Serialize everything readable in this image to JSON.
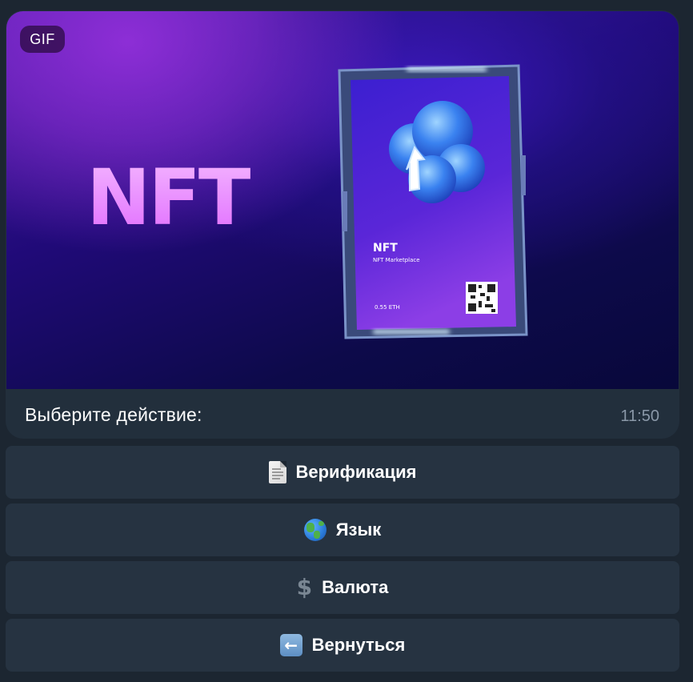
{
  "message": {
    "media_badge": "GIF",
    "media": {
      "headline": "NFT",
      "card_title": "NFT",
      "card_subtitle": "NFT Marketplace",
      "card_price": "0.55 ETH"
    },
    "caption": "Выберите действие:",
    "time": "11:50"
  },
  "keyboard": {
    "buttons": [
      {
        "label": "Верификация",
        "icon": "page-icon"
      },
      {
        "label": "Язык",
        "icon": "globe-icon"
      },
      {
        "label": "Валюта",
        "icon": "dollar-icon"
      },
      {
        "label": "Вернуться",
        "icon": "back-arrow-icon"
      }
    ]
  },
  "colors": {
    "background": "#1c2631",
    "bubble": "#222f3c",
    "button": "#263341",
    "time_text": "#8a98a8"
  }
}
